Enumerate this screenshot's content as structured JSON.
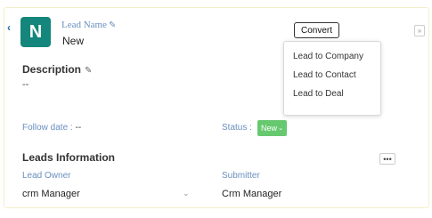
{
  "header": {
    "back_icon": "chevron-left-icon",
    "avatar_letter": "N",
    "avatar_color": "#14867b",
    "lead_name_label": "Lead Name",
    "lead_name_value": "New",
    "convert_label": "Convert",
    "expand_icon": "expand-icon"
  },
  "convert_menu": {
    "items": [
      {
        "label": "Lead to Company"
      },
      {
        "label": "Lead to Contact"
      },
      {
        "label": "Lead to Deal"
      }
    ]
  },
  "description": {
    "title": "Description",
    "value": "--"
  },
  "details": {
    "follow_label": "Follow date :",
    "follow_value": "--",
    "status_label": "Status :",
    "status_value": "New",
    "status_color": "#66c970"
  },
  "leads_info": {
    "title": "Leads Information",
    "more_label": "•••",
    "owner_label": "Lead Owner",
    "owner_value": "crm Manager",
    "submitter_label": "Submitter",
    "submitter_value": "Crm Manager"
  }
}
